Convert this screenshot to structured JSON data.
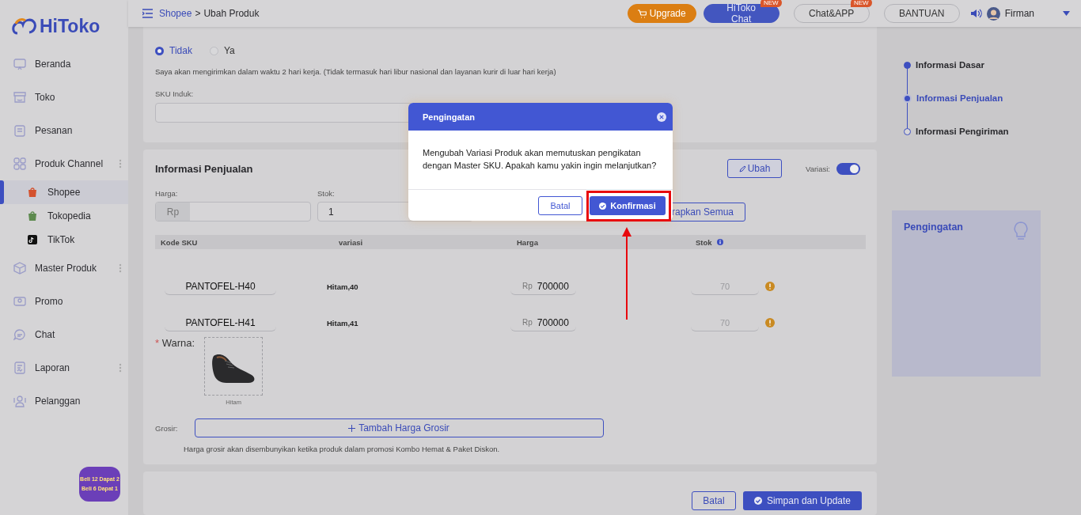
{
  "logo": "HiToko",
  "sidebar": {
    "items": [
      {
        "label": "Beranda",
        "selected": false,
        "more": false
      },
      {
        "label": "Toko",
        "selected": false,
        "more": false
      },
      {
        "label": "Pesanan",
        "selected": false,
        "more": false
      },
      {
        "label": "Produk Channel",
        "selected": false,
        "more": true,
        "expanded": true,
        "children": [
          {
            "label": "Shopee",
            "selected": true
          },
          {
            "label": "Tokopedia",
            "selected": false
          },
          {
            "label": "TikTok",
            "selected": false
          }
        ]
      },
      {
        "label": "Master Produk",
        "selected": false,
        "more": true
      },
      {
        "label": "Promo",
        "selected": false,
        "more": false
      },
      {
        "label": "Chat",
        "selected": false,
        "more": false
      },
      {
        "label": "Laporan",
        "selected": false,
        "more": true
      },
      {
        "label": "Pelanggan",
        "selected": false,
        "more": false
      }
    ],
    "promo_badge": [
      "Beli 12 Dapat 2",
      "Beli 6 Dapat 1"
    ]
  },
  "header": {
    "breadcrumb_link": "Shopee",
    "breadcrumb_separator": ">",
    "breadcrumb_current": "Ubah Produk",
    "actions": [
      {
        "label": "Upgrade",
        "kind": "upgrade"
      },
      {
        "label": "HiToko Chat",
        "kind": "primary",
        "badge": "NEW"
      },
      {
        "label": "Chat&APP",
        "kind": "outline",
        "badge": "NEW"
      },
      {
        "label": "BANTUAN",
        "kind": "outline"
      }
    ],
    "user": "Firman"
  },
  "pre_order": {
    "options": [
      {
        "label": "Tidak",
        "selected": true
      },
      {
        "label": "Ya",
        "selected": false
      }
    ],
    "note": "Saya akan mengirimkan dalam waktu 2 hari kerja. (Tidak termasuk hari libur nasional dan layanan kurir di luar hari kerja)",
    "sku_label": "SKU Induk:"
  },
  "sales": {
    "title": "Informasi Penjualan",
    "edit_button": "Ubah",
    "variation_label": "Variasi:",
    "variation_on": true,
    "price_label": "Harga:",
    "currency": "Rp",
    "stock_label": "Stok:",
    "stock_value": "1",
    "apply_button": "rapkan Semua",
    "columns": [
      "Kode SKU",
      "variasi",
      "Harga",
      "Stok"
    ],
    "rows": [
      {
        "sku": "PANTOFEL-H40",
        "variant": "Hitam,40",
        "currency": "Rp",
        "price": "700000",
        "stock": "70"
      },
      {
        "sku": "PANTOFEL-H41",
        "variant": "Hitam,41",
        "currency": "Rp",
        "price": "700000",
        "stock": "70"
      }
    ],
    "required_mark": "*",
    "color_label": "Warna:",
    "colors": [
      {
        "label": "Hitam"
      }
    ],
    "wholesale_label": "Grosir:",
    "wholesale_button": "Tambah Harga Grosir",
    "wholesale_note": "Harga grosir akan disembunyikan ketika produk dalam promosi Kombo Hemat & Paket Diskon."
  },
  "footer": {
    "cancel": "Batal",
    "save": "Simpan dan Update"
  },
  "steps": [
    {
      "label": "Informasi Dasar",
      "selected": false,
      "completed": true
    },
    {
      "label": "Informasi Penjualan",
      "selected": true,
      "completed": true
    },
    {
      "label": "Informasi Pengiriman",
      "selected": false,
      "completed": false
    }
  ],
  "tips": {
    "title": "Pengingatan"
  },
  "dialog": {
    "title": "Pengingatan",
    "message": "Mengubah Variasi Produk akan memutuskan pengikatan dengan Master SKU. Apakah kamu yakin ingin melanjutkan?",
    "cancel": "Batal",
    "confirm": "Konfirmasi"
  }
}
